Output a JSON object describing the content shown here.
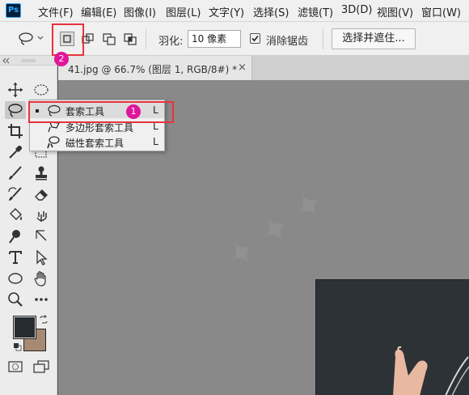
{
  "app": {
    "logo_text": "Ps"
  },
  "menu": {
    "items": [
      "文件(F)",
      "编辑(E)",
      "图像(I)",
      "图层(L)",
      "文字(Y)",
      "选择(S)",
      "滤镜(T)",
      "3D(D)",
      "视图(V)",
      "窗口(W)"
    ]
  },
  "options_bar": {
    "feather_label": "羽化:",
    "feather_value": "10 像素",
    "antialias_label": "消除锯齿",
    "antialias_checked": true,
    "select_and_mask_label": "选择并遮住..."
  },
  "document_tab": {
    "title": "41.jpg @ 66.7% (图层 1, RGB/8#) *",
    "close_glyph": "×"
  },
  "flyout": {
    "items": [
      {
        "label": "套索工具",
        "shortcut": "L",
        "active": true
      },
      {
        "label": "多边形套索工具",
        "shortcut": "L",
        "active": false
      },
      {
        "label": "磁性套索工具",
        "shortcut": "L",
        "active": false
      }
    ]
  },
  "annotations": {
    "badge_1": "1",
    "badge_2": "2",
    "highlight_color": "#e8323c",
    "badge_color": "#e0169a"
  },
  "colors": {
    "foreground": "#262b30",
    "background": "#a68a74"
  }
}
